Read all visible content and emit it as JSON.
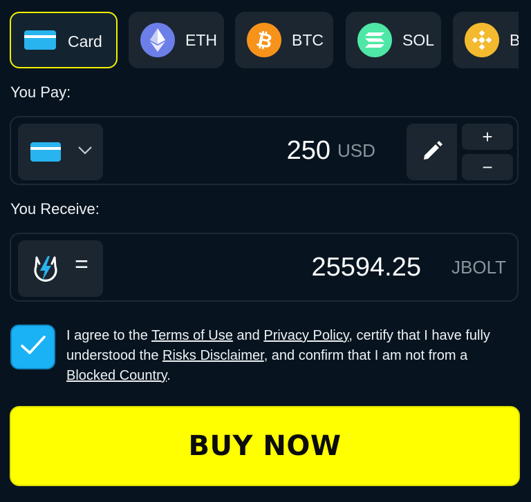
{
  "payment_methods": [
    {
      "label": "Card",
      "icon": "credit-card-icon",
      "active": true
    },
    {
      "label": "ETH",
      "icon": "ethereum-icon",
      "color": "#6c7fe9"
    },
    {
      "label": "BTC",
      "icon": "bitcoin-icon",
      "color": "#f7931a"
    },
    {
      "label": "SOL",
      "icon": "solana-icon",
      "color": "#4ee7a6"
    },
    {
      "label": "B",
      "icon": "bnb-icon",
      "color": "#f3ba2f"
    }
  ],
  "pay": {
    "label": "You Pay:",
    "amount": "250",
    "currency": "USD",
    "plus": "+",
    "minus": "−"
  },
  "receive": {
    "label": "You Receive:",
    "equals": "=",
    "amount": "25594.25",
    "currency": "JBOLT"
  },
  "agreement": {
    "checked": true,
    "t1": "I agree to the ",
    "terms": "Terms of Use",
    "t2": " and ",
    "privacy": "Privacy Policy",
    "t3": ", certify that I have fully understood the ",
    "risks": "Risks Disclaimer",
    "t4": ", and confirm that I am not from a ",
    "blocked": "Blocked Country",
    "t5": "."
  },
  "buy_button": "BUY NOW",
  "colors": {
    "background": "#07141f",
    "accent_yellow": "#ffff00",
    "card_blue": "#28b4ef",
    "checkbox_blue": "#1ab2f4"
  }
}
